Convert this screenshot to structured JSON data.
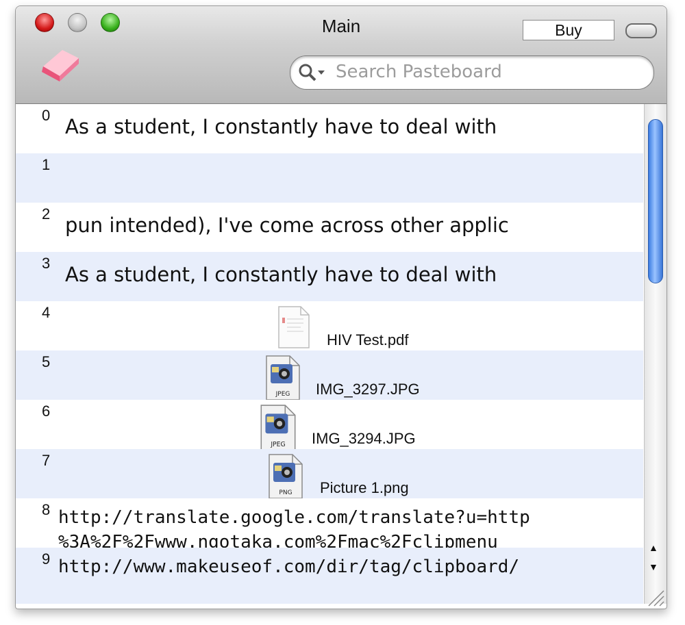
{
  "window": {
    "title": "Main",
    "buy_label": "Buy"
  },
  "toolbar": {
    "search_placeholder": "Search Pasteboard"
  },
  "rows": [
    {
      "index": "0",
      "kind": "text",
      "text": "As a student, I constantly have to deal with"
    },
    {
      "index": "1",
      "kind": "text",
      "text": ""
    },
    {
      "index": "2",
      "kind": "text",
      "text": "pun intended), I've come across other applic"
    },
    {
      "index": "3",
      "kind": "text",
      "text": "As a student, I constantly have to deal with"
    },
    {
      "index": "4",
      "kind": "file",
      "name": "HIV Test.pdf",
      "icon": "pdf-file-icon"
    },
    {
      "index": "5",
      "kind": "file",
      "name": "IMG_3297.JPG",
      "icon": "jpeg-file-icon",
      "badge": "JPEG"
    },
    {
      "index": "6",
      "kind": "file",
      "name": "IMG_3294.JPG",
      "icon": "jpeg-file-icon",
      "badge": "JPEG"
    },
    {
      "index": "7",
      "kind": "file",
      "name": "Picture 1.png",
      "icon": "png-file-icon",
      "badge": "PNG"
    },
    {
      "index": "8",
      "kind": "url",
      "line1": "http://translate.google.com/translate?u=http",
      "line2": "%3A%2F%2Fwww.ngotaka.com%2Fmac%2Fclipmenu"
    },
    {
      "index": "9",
      "kind": "url",
      "line1": "http://www.makeuseof.com/dir/tag/clipboard/"
    }
  ],
  "colors": {
    "row_alt": "#e8eefb",
    "scroll_thumb": "#5a95ef",
    "close": "#d41a1a",
    "maximize": "#38b01c"
  }
}
